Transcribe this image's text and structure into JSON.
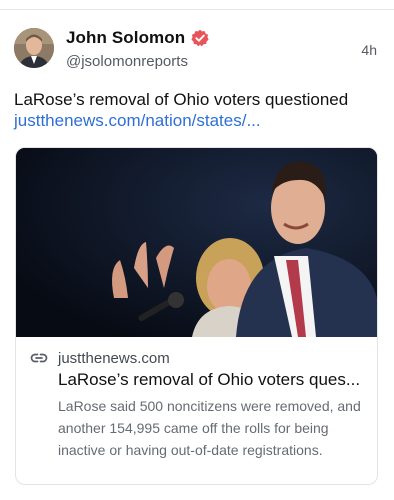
{
  "post": {
    "author_name": "John Solomon",
    "handle": "@jsolomonreports",
    "time": "4h",
    "text": "LaRose’s removal of Ohio voters questioned",
    "link": "justthenews.com/nation/states/..."
  },
  "card": {
    "domain": "justthenews.com",
    "title": "LaRose’s removal of Ohio voters ques...",
    "description": "LaRose said 500 noncitizens were removed, and another 154,995 came off the rolls for being inactive or having out-of-date registrations."
  },
  "icons": {
    "verified": "verified-badge-icon",
    "link": "link-icon"
  },
  "colors": {
    "verified_badge": "#e8545a",
    "link_text": "#2d6fd6"
  }
}
